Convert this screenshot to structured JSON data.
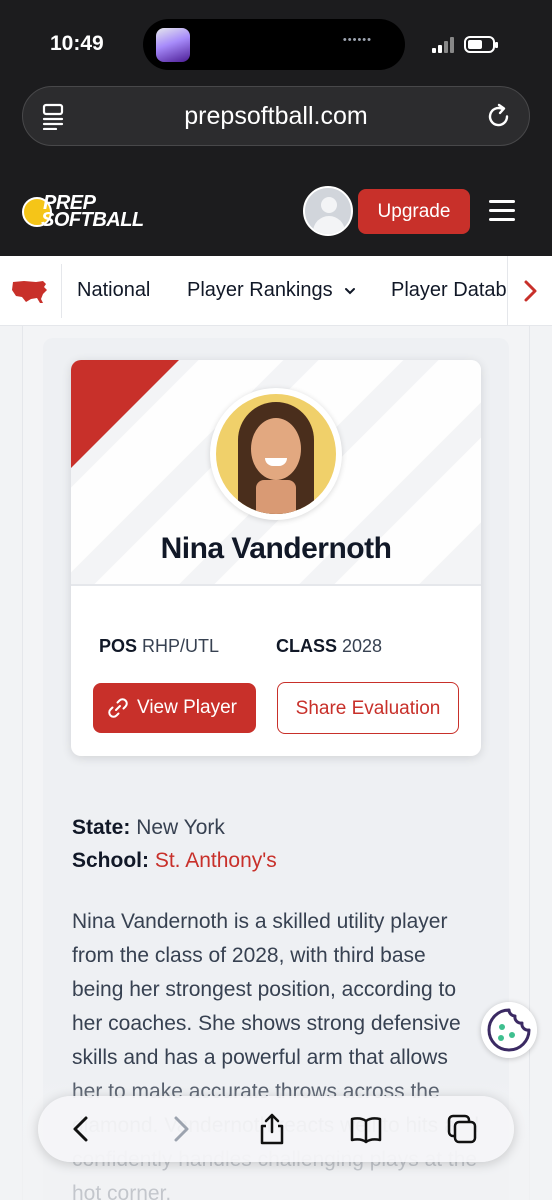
{
  "status_bar": {
    "time": "10:49"
  },
  "browser": {
    "url": "prepsoftball.com"
  },
  "site_header": {
    "logo_line1": "PREP",
    "logo_line2": "SOFTBALL",
    "upgrade_label": "Upgrade"
  },
  "nav": {
    "items": [
      {
        "label": "National"
      },
      {
        "label": "Player Rankings"
      },
      {
        "label": "Player Datab"
      }
    ]
  },
  "player": {
    "name": "Nina Vandernoth",
    "pos_label": "POS",
    "pos_value": "RHP/UTL",
    "class_label": "CLASS",
    "class_value": "2028",
    "view_label": "View Player",
    "share_label": "Share Evaluation",
    "state_label": "State:",
    "state_value": "New York",
    "school_label": "School:",
    "school_value": "St. Anthony's",
    "bio": "Nina Vandernoth is a skilled utility player from the class of 2028, with third base being her strongest position, according to her coaches. She shows strong defensive skills and has a powerful arm that allows her to make accurate throws across the diamond. Vandernoth reacts well to hits and confidently handles challenging plays at the hot corner."
  },
  "colors": {
    "accent": "#c8302a",
    "chrome": "#1c1c1e"
  },
  "icons": {
    "reader": "reader-mode-icon",
    "reload": "reload-icon",
    "menu": "hamburger-menu-icon",
    "usa": "usa-map-icon",
    "next": "chevron-right-icon",
    "link": "link-icon",
    "cookie": "cookie-icon",
    "back": "back-icon",
    "forward": "forward-icon",
    "share": "share-icon",
    "bookmarks": "book-icon",
    "tabs": "tabs-icon"
  }
}
